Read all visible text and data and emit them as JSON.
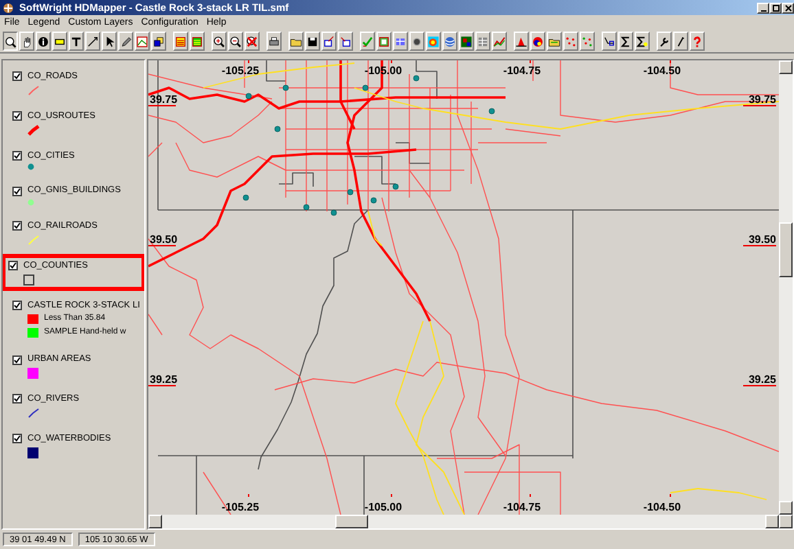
{
  "window": {
    "title": "SoftWright HDMapper - Castle Rock 3-stack LR TIL.smf"
  },
  "menu": [
    "File",
    "Legend",
    "Custom Layers",
    "Configuration",
    "Help"
  ],
  "legend": [
    {
      "name": "CO_ROADS",
      "checked": true,
      "selected": false,
      "swatch": {
        "kind": "line",
        "color": "#ff6060"
      }
    },
    {
      "name": "CO_USROUTES",
      "checked": true,
      "selected": false,
      "swatch": {
        "kind": "thick-line",
        "color": "#ff0000"
      }
    },
    {
      "name": "CO_CITIES",
      "checked": true,
      "selected": false,
      "swatch": {
        "kind": "marker",
        "color": "#109090"
      }
    },
    {
      "name": "CO_GNIS_BUILDINGS",
      "checked": true,
      "selected": false,
      "swatch": {
        "kind": "marker",
        "color": "#90ff90"
      }
    },
    {
      "name": "CO_RAILROADS",
      "checked": true,
      "selected": false,
      "swatch": {
        "kind": "line",
        "color": "#ffff40"
      }
    },
    {
      "name": "CO_COUNTIES",
      "checked": true,
      "selected": true,
      "swatch": {
        "kind": "outline",
        "color": "#404040"
      }
    },
    {
      "name": "CASTLE ROCK 3-STACK LI",
      "checked": true,
      "selected": false,
      "swatch": {
        "kind": "ranges",
        "entries": [
          {
            "label": "Less Than 35.84",
            "color": "#ff0000"
          },
          {
            "label": "SAMPLE Hand-held w",
            "color": "#00ff00"
          }
        ]
      }
    },
    {
      "name": "URBAN AREAS",
      "checked": true,
      "selected": false,
      "swatch": {
        "kind": "fill",
        "color": "#ff00ff"
      }
    },
    {
      "name": "CO_RIVERS",
      "checked": true,
      "selected": false,
      "swatch": {
        "kind": "line",
        "color": "#3030c0"
      }
    },
    {
      "name": "CO_WATERBODIES",
      "checked": true,
      "selected": false,
      "swatch": {
        "kind": "fill",
        "color": "#000070"
      }
    }
  ],
  "map": {
    "top_labels": [
      "-105.25",
      "-105.00",
      "-104.75",
      "-104.50"
    ],
    "bottom_labels": [
      "-105.25",
      "-105.00",
      "-104.75",
      "-104.50"
    ],
    "left_labels": [
      "39.75",
      "39.50",
      "39.25"
    ],
    "right_labels": [
      "39.75",
      "39.50",
      "39.25"
    ]
  },
  "status_bar": [
    "39 01 49.49 N",
    "105 10 30.65 W"
  ]
}
